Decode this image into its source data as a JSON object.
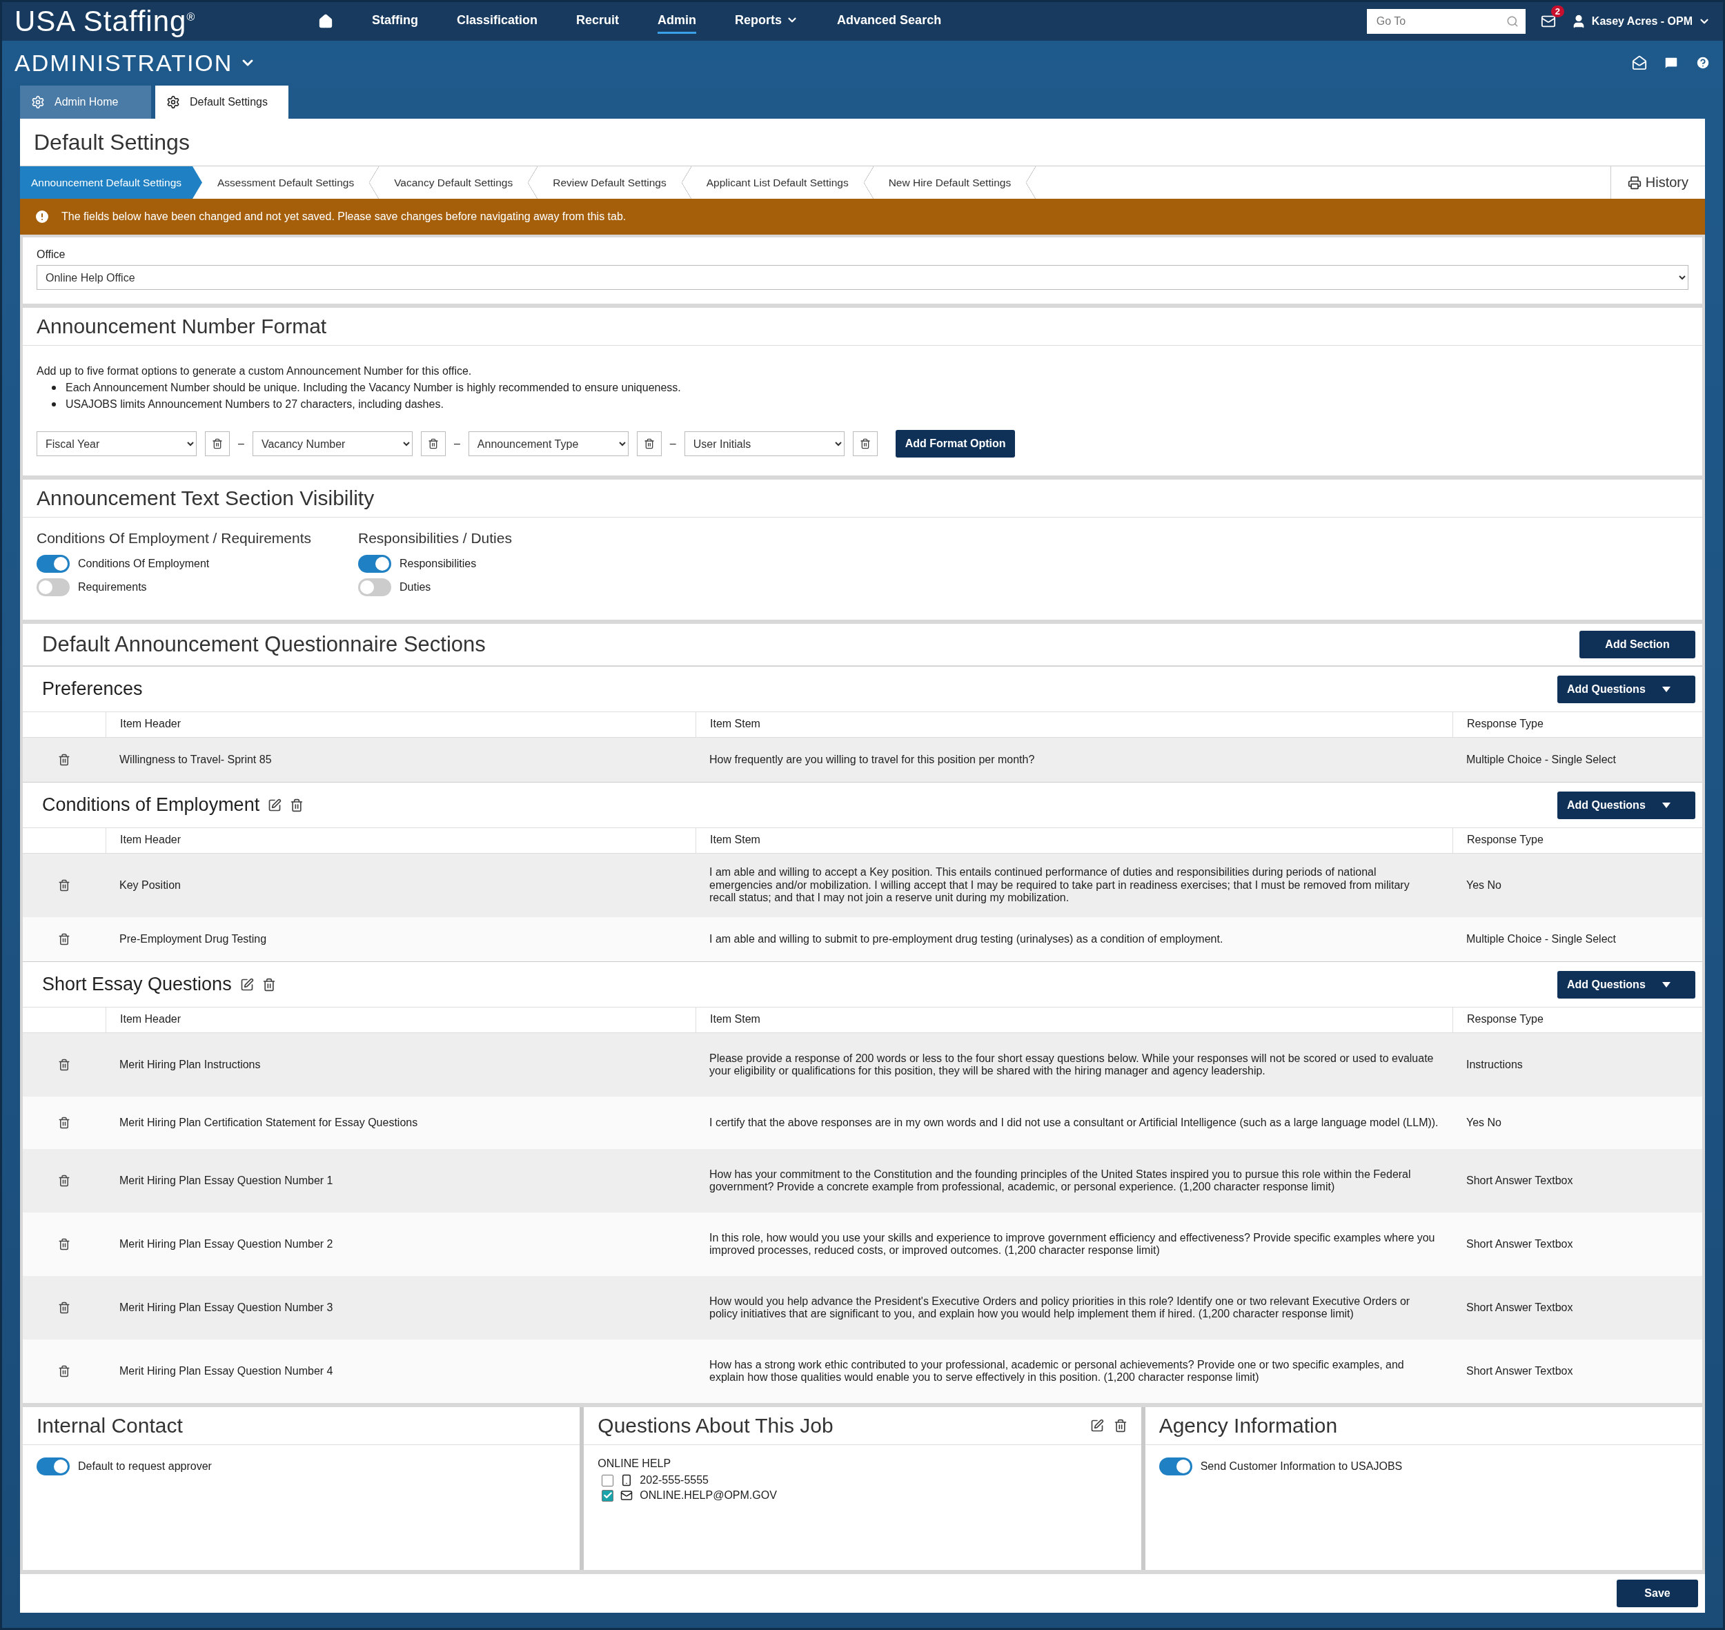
{
  "header": {
    "logo": "USA Staffing$^{®}$",
    "nav": [
      {
        "label": "Staffing",
        "selected": false,
        "dropdown": false
      },
      {
        "label": "Classification",
        "selected": false,
        "dropdown": false
      },
      {
        "label": "Recruit",
        "selected": false,
        "dropdown": false
      },
      {
        "label": "Admin",
        "selected": true,
        "dropdown": false
      },
      {
        "label": "Reports",
        "selected": false,
        "dropdown": true
      },
      {
        "label": "Advanced Search",
        "selected": false,
        "dropdown": false
      }
    ],
    "search": {
      "placeholder": "Go To"
    },
    "notification_count": "2",
    "user": "Kasey Acres - OPM"
  },
  "module_title": "ADMINISTRATION",
  "page_tabs": [
    {
      "label": "Admin Home",
      "selected": false
    },
    {
      "label": "Default Settings",
      "selected": true
    }
  ],
  "page_title": "Default Settings",
  "section_tabs": [
    {
      "label": "Announcement Default Settings",
      "selected": true
    },
    {
      "label": "Assessment Default Settings",
      "selected": false
    },
    {
      "label": "Vacancy Default Settings",
      "selected": false
    },
    {
      "label": "Review Default Settings",
      "selected": false
    },
    {
      "label": "Applicant List Default Settings",
      "selected": false
    },
    {
      "label": "New Hire Default Settings",
      "selected": false
    }
  ],
  "history_button": "History",
  "warning": "The fields below have been changed and not yet saved. Please save changes before navigating away from this tab.",
  "office": {
    "label": "Office",
    "value": "Online Help Office"
  },
  "number_format": {
    "title": "Announcement Number Format",
    "intro": "Add up to five format options to generate a custom Announcement Number for this office.",
    "bullets": [
      "Each Announcement Number should be unique. Including the Vacancy Number is highly recommended to ensure uniqueness.",
      "USAJOBS limits Announcement Numbers to 27 characters, including dashes."
    ],
    "options": [
      "Fiscal Year",
      "Vacancy Number",
      "Announcement Type",
      "User Initials"
    ],
    "separator": "–",
    "add_button": "Add Format Option"
  },
  "visibility": {
    "title": "Announcement Text Section Visibility",
    "groups": [
      {
        "title": "Conditions Of Employment / Requirements",
        "toggles": [
          {
            "label": "Conditions Of Employment",
            "on": true
          },
          {
            "label": "Requirements",
            "on": false
          }
        ]
      },
      {
        "title": "Responsibilities / Duties",
        "toggles": [
          {
            "label": "Responsibilities",
            "on": true
          },
          {
            "label": "Duties",
            "on": false
          }
        ]
      }
    ]
  },
  "questionnaire": {
    "title": "Default Announcement Questionnaire Sections",
    "add_section": "Add Section",
    "sections": [
      {
        "title": "Preferences",
        "editable": false,
        "add_button": "Add Questions",
        "columns": [
          "Item Header",
          "Item Stem",
          "Response Type"
        ],
        "rows": [
          {
            "header": "Willingness to Travel- Sprint 85",
            "stem": "How frequently are you willing to travel for this position per month?",
            "response": "Multiple Choice - Single Select"
          }
        ]
      },
      {
        "title": "Conditions of Employment",
        "editable": true,
        "add_button": "Add Questions",
        "columns": [
          "Item Header",
          "Item Stem",
          "Response Type"
        ],
        "rows": [
          {
            "header": "Key Position",
            "stem": "I am able and willing to accept a Key position. This entails continued performance of duties and responsibilities during periods of national emergencies and/or mobilization. I willing accept that I may be required to take part in readiness exercises; that I must be removed from military recall status; and that I may not join a reserve unit during my mobilization.",
            "response": "Yes No"
          },
          {
            "header": "Pre-Employment Drug Testing",
            "stem": "I am able and willing to submit to pre-employment drug testing (urinalyses) as a condition of employment.",
            "response": "Multiple Choice - Single Select"
          }
        ]
      },
      {
        "title": "Short Essay Questions",
        "editable": true,
        "add_button": "Add Questions",
        "columns": [
          "Item Header",
          "Item Stem",
          "Response Type"
        ],
        "rows": [
          {
            "header": "Merit Hiring Plan Instructions",
            "stem": "Please provide a response of 200 words or less to the four short essay questions below. While your responses will not be scored or used to evaluate your eligibility or qualifications for this position, they will be shared with the hiring manager and agency leadership.",
            "response": "Instructions"
          },
          {
            "header": "Merit Hiring Plan Certification Statement for Essay Questions",
            "stem": "I certify that the above responses are in my own words and I did not use a consultant or Artificial Intelligence (such as a large language model (LLM)).",
            "response": "Yes No"
          },
          {
            "header": "Merit Hiring Plan Essay Question Number 1",
            "stem": "How has your commitment to the Constitution and the founding principles of the United States inspired you to pursue this role within the Federal government? Provide a concrete example from professional, academic, or personal experience. (1,200 character response limit)",
            "response": "Short Answer Textbox"
          },
          {
            "header": "Merit Hiring Plan Essay Question Number 2",
            "stem": "In this role, how would you use your skills and experience to improve government efficiency and effectiveness? Provide specific examples where you improved processes, reduced costs, or improved outcomes. (1,200 character response limit)",
            "response": "Short Answer Textbox"
          },
          {
            "header": "Merit Hiring Plan Essay Question Number 3",
            "stem": "How would you help advance the President's Executive Orders and policy priorities in this role? Identify one or two relevant Executive Orders or policy initiatives that are significant to you, and explain how you would help implement them if hired. (1,200 character response limit)",
            "response": "Short Answer Textbox"
          },
          {
            "header": "Merit Hiring Plan Essay Question Number 4",
            "stem": "How has a strong work ethic contributed to your professional, academic or personal achievements? Provide one or two specific examples, and explain how those qualities would enable you to serve effectively in this position. (1,200 character response limit)",
            "response": "Short Answer Textbox"
          }
        ]
      }
    ]
  },
  "internal_contact": {
    "title": "Internal Contact",
    "toggle": {
      "label": "Default to request approver",
      "on": true
    }
  },
  "questions_about_job": {
    "title": "Questions About This Job",
    "contact_name": "ONLINE HELP",
    "items": [
      {
        "kind": "phone",
        "value": "202-555-5555",
        "checked": false
      },
      {
        "kind": "email",
        "value": "ONLINE.HELP@OPM.GOV",
        "checked": true
      }
    ]
  },
  "agency_information": {
    "title": "Agency Information",
    "toggle": {
      "label": "Send Customer Information to USAJOBS",
      "on": true
    }
  },
  "save_button": "Save"
}
